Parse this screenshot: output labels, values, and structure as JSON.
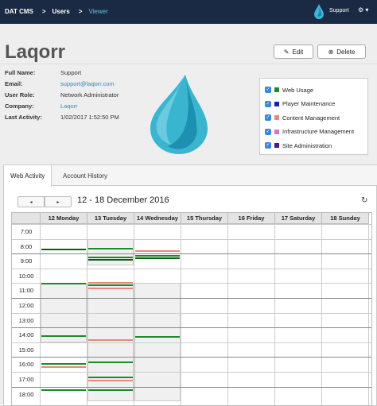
{
  "navbar": {
    "breadcrumbs": [
      "DAT CMS",
      "Users",
      "Viewer"
    ],
    "separator": ">",
    "user_label": "Support",
    "gear_label": "⚙ ▾"
  },
  "header": {
    "title": "Laqorr",
    "edit_label": "Edit",
    "delete_label": "Delete",
    "edit_icon": "✎",
    "delete_icon": "⊗"
  },
  "info": {
    "full_name_key": "Full Name:",
    "full_name": "Support",
    "email_key": "Email:",
    "email": "support@laqorr.com",
    "role_key": "User Role:",
    "role": "Network Administrator",
    "company_key": "Company:",
    "company": "Laqorr",
    "activity_key": "Last Activity:",
    "activity": "1/02/2017  1:52:50 PM"
  },
  "legend": [
    {
      "label": "Web Usage",
      "color": "#1a8a2a"
    },
    {
      "label": "Player Maintenance",
      "color": "#1020c8"
    },
    {
      "label": "Content Management",
      "color": "#e8877a"
    },
    {
      "label": "Infrastructure Management",
      "color": "#e070d0"
    },
    {
      "label": "Site Administration",
      "color": "#4a1a8a"
    }
  ],
  "tabs": {
    "active": "Web Activity",
    "inactive": "Account History"
  },
  "calendar": {
    "prev_label": "◂",
    "next_label": "▸",
    "title": "12 - 18 December 2016",
    "refresh_icon": "↻",
    "days": [
      "12 Monday",
      "13 Tuesday",
      "14 Wednesday",
      "15 Thursday",
      "16 Friday",
      "17 Saturday",
      "18 Sunday"
    ],
    "hours": [
      "7:00",
      "8:00",
      "9:00",
      "10:00",
      "11:00",
      "12:00",
      "13:00",
      "14:00",
      "15:00",
      "16:00",
      "17:00",
      "18:00"
    ]
  }
}
